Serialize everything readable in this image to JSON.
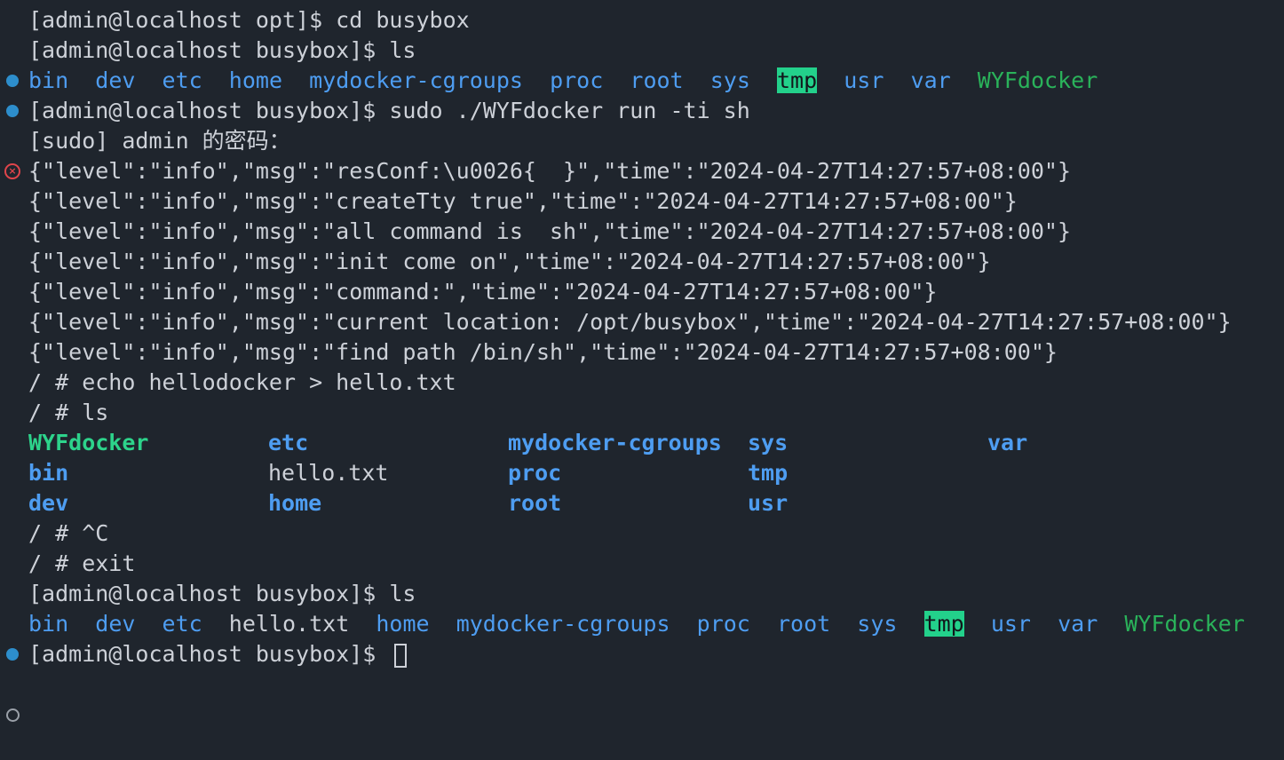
{
  "lines": {
    "l1": "[admin@localhost opt]$ cd busybox",
    "l2": "[admin@localhost busybox]$ ls",
    "l4": "[admin@localhost busybox]$ sudo ./WYFdocker run -ti sh",
    "l5": "[sudo] admin 的密码：",
    "l6": "{\"level\":\"info\",\"msg\":\"resConf:\\u0026{  }\",\"time\":\"2024-04-27T14:27:57+08:00\"}",
    "l7": "{\"level\":\"info\",\"msg\":\"createTty true\",\"time\":\"2024-04-27T14:27:57+08:00\"}",
    "l8": "{\"level\":\"info\",\"msg\":\"all command is  sh\",\"time\":\"2024-04-27T14:27:57+08:00\"}",
    "l9": "{\"level\":\"info\",\"msg\":\"init come on\",\"time\":\"2024-04-27T14:27:57+08:00\"}",
    "l10": "{\"level\":\"info\",\"msg\":\"command:\",\"time\":\"2024-04-27T14:27:57+08:00\"}",
    "l11": "{\"level\":\"info\",\"msg\":\"current location: /opt/busybox\",\"time\":\"2024-04-27T14:27:57+08:00\"}",
    "l12": "{\"level\":\"info\",\"msg\":\"find path /bin/sh\",\"time\":\"2024-04-27T14:27:57+08:00\"}",
    "l13": "/ # echo hellodocker > hello.txt",
    "l14": "/ # ls",
    "l18": "/ # ^C",
    "l19": "/ # exit",
    "l20": "[admin@localhost busybox]$ ls",
    "l22": "[admin@localhost busybox]$ "
  },
  "ls1": {
    "bin": "bin",
    "dev": "dev",
    "etc": "etc",
    "home": "home",
    "mydocker": "mydocker-cgroups",
    "proc": "proc",
    "root": "root",
    "sys": "sys",
    "tmp": "tmp",
    "usr": "usr",
    "var": "var",
    "wyf": "WYFdocker"
  },
  "ls_container": {
    "r1": [
      "WYFdocker",
      "etc",
      "mydocker-cgroups",
      "sys",
      "var"
    ],
    "r2": [
      "bin",
      "hello.txt",
      "proc",
      "tmp"
    ],
    "r3": [
      "dev",
      "home",
      "root",
      "usr"
    ]
  },
  "ls2": {
    "bin": "bin",
    "dev": "dev",
    "etc": "etc",
    "hello": "hello.txt",
    "home": "home",
    "mydocker": "mydocker-cgroups",
    "proc": "proc",
    "root": "root",
    "sys": "sys",
    "tmp": "tmp",
    "usr": "usr",
    "var": "var",
    "wyf": "WYFdocker"
  },
  "icons": {
    "success": "blue-dot-icon",
    "error": "error-x-icon",
    "pending": "hollow-circle-icon"
  },
  "colors": {
    "background": "#1f252d",
    "dir": "#4e9df1",
    "exec": "#2ab25a",
    "highlight": "#23d18b"
  }
}
